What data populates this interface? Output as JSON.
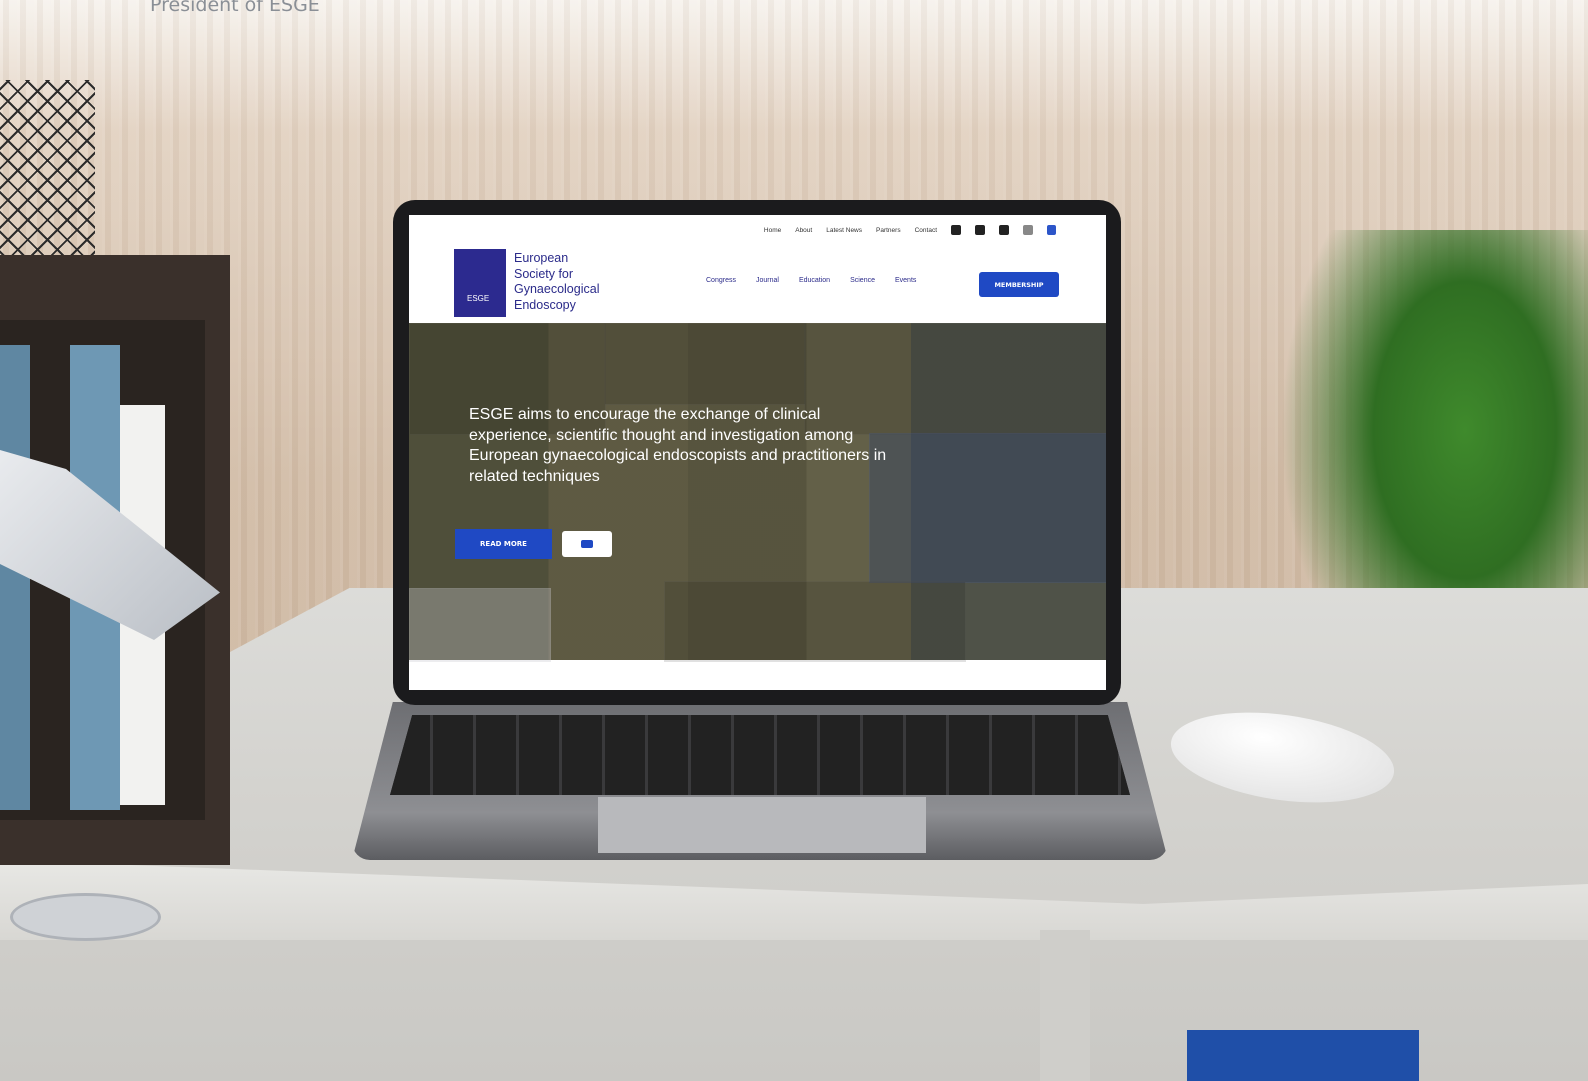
{
  "caption": "President of ESGE",
  "website": {
    "top_nav": [
      "Home",
      "About",
      "Latest News",
      "Partners",
      "Contact"
    ],
    "social_icons": [
      "facebook-icon",
      "twitter-icon",
      "linkedin-icon",
      "instagram-icon"
    ],
    "brand_lines": [
      "European",
      "Society for",
      "Gynaecological",
      "Endoscopy"
    ],
    "logo_text": "ESGE",
    "main_nav": [
      "Congress",
      "Journal",
      "Education",
      "Science",
      "Events"
    ],
    "membership_label": "MEMBERSHIP",
    "hero_text": "ESGE aims to encourage the exchange of clinical experience, scientific thought and investigation among European gynaecological endoscopists and practitioners in related techniques",
    "read_more_label": "READ MORE"
  },
  "colors": {
    "brand_blue": "#1f49c4",
    "logo_navy": "#2c2a8f"
  }
}
